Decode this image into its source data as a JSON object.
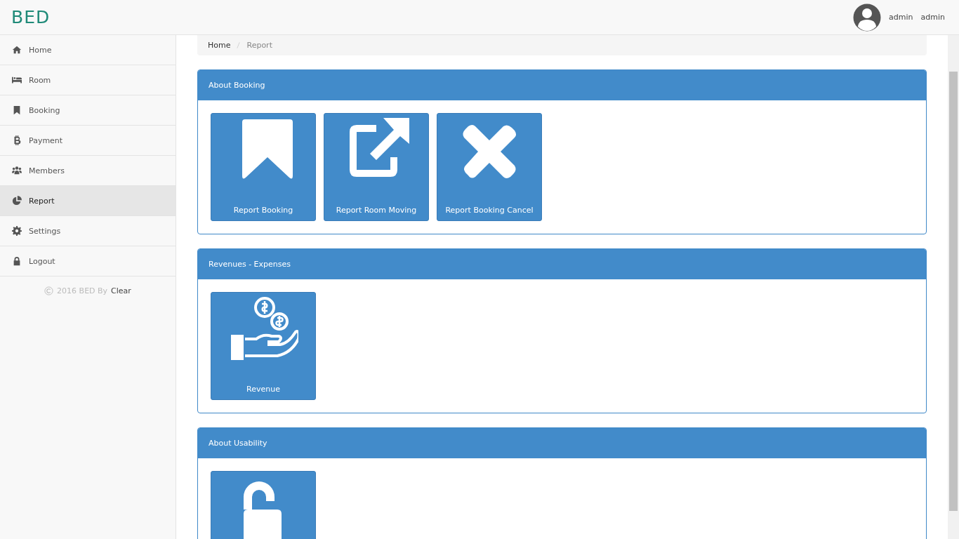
{
  "brand": "BED",
  "user": {
    "name": "admin",
    "role": "admin"
  },
  "sidebar": {
    "items": [
      {
        "label": "Home",
        "selected": false
      },
      {
        "label": "Room",
        "selected": false
      },
      {
        "label": "Booking",
        "selected": false
      },
      {
        "label": "Payment",
        "selected": false
      },
      {
        "label": "Members",
        "selected": false
      },
      {
        "label": "Report",
        "selected": true
      },
      {
        "label": "Settings",
        "selected": false
      },
      {
        "label": "Logout",
        "selected": false
      }
    ],
    "footer": {
      "year": "2016 BED By",
      "author": "Clear"
    }
  },
  "breadcrumb": [
    {
      "label": "Home",
      "current": false
    },
    {
      "label": "Report",
      "current": true
    }
  ],
  "panels": [
    {
      "title": "About Booking",
      "tiles": [
        {
          "kind": "labeled",
          "label": "Report Booking"
        },
        {
          "kind": "labeled",
          "label": "Report Room Moving"
        },
        {
          "kind": "labeled",
          "label": "Report Booking Cancel"
        }
      ]
    },
    {
      "title": "Revenues - Expenses",
      "tiles": [
        {
          "kind": "labeled",
          "label": "Revenue"
        }
      ]
    },
    {
      "title": "About Usability",
      "tiles": [
        {
          "kind": "cut"
        }
      ]
    }
  ]
}
